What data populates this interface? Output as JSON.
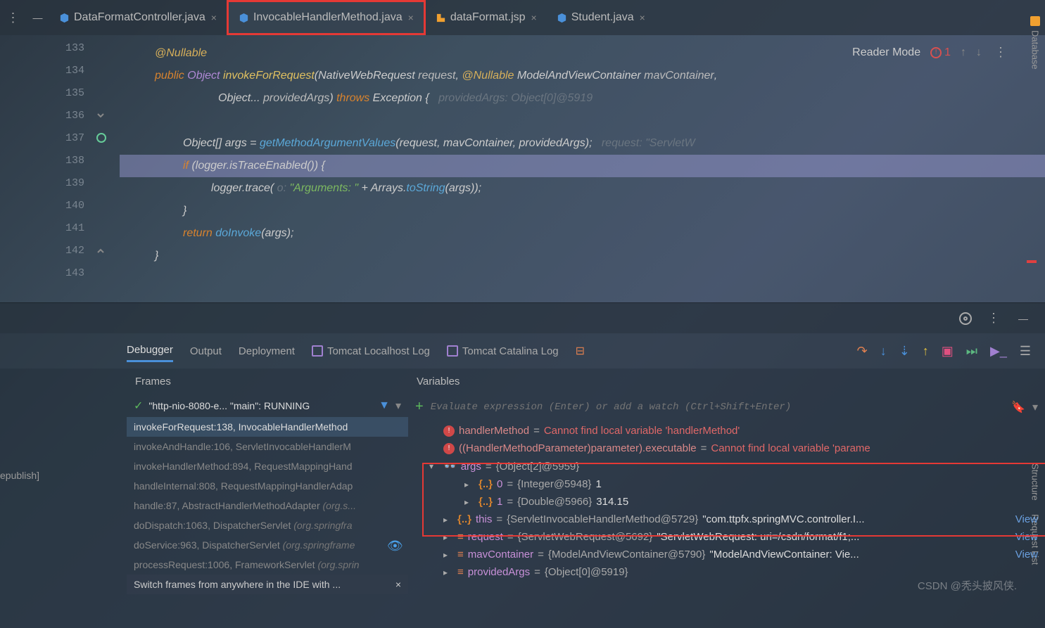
{
  "tabs": [
    {
      "label": "DataFormatController.java",
      "icon": "java-class",
      "color": "#4a90d9"
    },
    {
      "label": "InvocableHandlerMethod.java",
      "icon": "java-class",
      "color": "#4a90d9",
      "active": true,
      "highlighted": true
    },
    {
      "label": "dataFormat.jsp",
      "icon": "jsp",
      "color": "#f0a030"
    },
    {
      "label": "Student.java",
      "icon": "java-class",
      "color": "#4a90d9"
    }
  ],
  "reader_mode": "Reader Mode",
  "error_count": "1",
  "right_tools": [
    "Database",
    "Structure",
    "Request List"
  ],
  "code": {
    "lines": [
      133,
      134,
      135,
      136,
      137,
      138,
      139,
      140,
      141,
      142,
      143
    ],
    "row133": "@Nullable",
    "row134_pre": "public ",
    "row134_type": "Object ",
    "row134_fn": "invokeForRequest",
    "row134_p1": "(NativeWebRequest ",
    "row134_a1": "request",
    "row134_c": ", ",
    "row134_ann": "@Nullable ",
    "row134_p2": "ModelAndViewContainer ",
    "row134_a2": "mavContainer",
    "row134_end": ",",
    "row135_pre": "Object... ",
    "row135_a": "providedArgs",
    "row135_m": ") ",
    "row135_kw": "throws ",
    "row135_ex": "Exception ",
    "row135_b": "{",
    "row135_hint": "   providedArgs: Object[0]@5919",
    "row137_pre": "Object[] ",
    "row137_v": "args ",
    "row137_eq": "= ",
    "row137_fn": "getMethodArgumentValues",
    "row137_args": "(request, mavContainer, providedArgs);",
    "row137_hint": "   request: \"ServletW",
    "row138_kw": "if ",
    "row138_body": "(logger.isTraceEnabled()) {",
    "row139_pre": "logger.trace(",
    "row139_hint": " o: ",
    "row139_str": "\"Arguments: \"",
    "row139_mid": " + Arrays.",
    "row139_fn": "toString",
    "row139_end": "(args));",
    "row140": "}",
    "row141_kw": "return ",
    "row141_fn": "doInvoke",
    "row141_end": "(args);",
    "row142": "}"
  },
  "debug_tabs": [
    "Debugger",
    "Output",
    "Deployment",
    "Tomcat Localhost Log",
    "Tomcat Catalina Log"
  ],
  "frames": {
    "title": "Frames",
    "thread": "\"http-nio-8080-e... \"main\": RUNNING",
    "items": [
      {
        "text": "invokeForRequest:138, InvocableHandlerMethod",
        "selected": true
      },
      {
        "text": "invokeAndHandle:106, ServletInvocableHandlerM"
      },
      {
        "text": "invokeHandlerMethod:894, RequestMappingHand"
      },
      {
        "text": "handleInternal:808, RequestMappingHandlerAdap"
      },
      {
        "text": "handle:87, AbstractHandlerMethodAdapter ",
        "loc": "(org.s..."
      },
      {
        "text": "doDispatch:1063, DispatcherServlet ",
        "loc": "(org.springfra"
      },
      {
        "text": "doService:963, DispatcherServlet ",
        "loc": "(org.springframe"
      },
      {
        "text": "processRequest:1006, FrameworkServlet ",
        "loc": "(org.sprin"
      }
    ],
    "hint": "Switch frames from anywhere in the IDE with ..."
  },
  "variables": {
    "title": "Variables",
    "eval_placeholder": "Evaluate expression (Enter) or add a watch (Ctrl+Shift+Enter)",
    "rows": [
      {
        "type": "error",
        "name": "handlerMethod",
        "val": "Cannot find local variable 'handlerMethod'"
      },
      {
        "type": "error",
        "name": "((HandlerMethodParameter)parameter).executable",
        "val": "Cannot find local variable 'parame"
      },
      {
        "type": "watch",
        "expand": "down",
        "name": "args",
        "val": "{Object[2]@5959}",
        "boxed": true
      },
      {
        "type": "elem",
        "lvl": 2,
        "expand": "right",
        "name": "0",
        "val": "{Integer@5948} ",
        "valstr": "1"
      },
      {
        "type": "elem",
        "lvl": 2,
        "expand": "right",
        "name": "1",
        "val": "{Double@5966} ",
        "valstr": "314.15"
      },
      {
        "type": "obj",
        "lvl": 1,
        "expand": "right",
        "name": "this",
        "val": "{ServletInvocableHandlerMethod@5729} ",
        "valstr": "\"com.ttpfx.springMVC.controller.I...",
        "view": true
      },
      {
        "type": "list",
        "lvl": 1,
        "expand": "right",
        "name": "request",
        "val": "{ServletWebRequest@5692} ",
        "valstr": "\"ServletWebRequest: uri=/csdn/format/f1;...",
        "view": true
      },
      {
        "type": "list",
        "lvl": 1,
        "expand": "right",
        "name": "mavContainer",
        "val": "{ModelAndViewContainer@5790} ",
        "valstr": "\"ModelAndViewContainer: Vie...",
        "view": true
      },
      {
        "type": "list",
        "lvl": 1,
        "expand": "right",
        "name": "providedArgs",
        "val": "{Object[0]@5919}"
      }
    ]
  },
  "left_text": "epublish]",
  "watermark": "CSDN @秃头披风侠."
}
